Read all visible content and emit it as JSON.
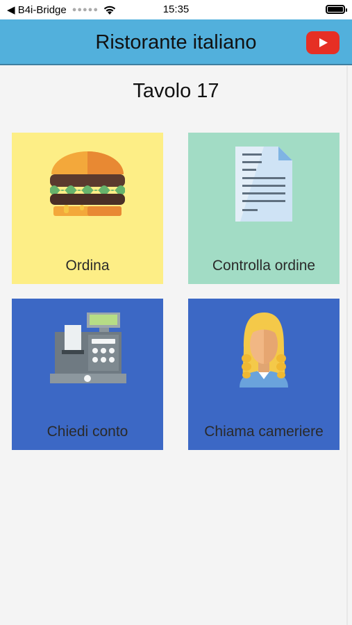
{
  "status_bar": {
    "back_label": "◀ B4i-Bridge",
    "dots": "●●●●●",
    "time": "15:35"
  },
  "navbar": {
    "title": "Ristorante italiano",
    "youtube_icon": "youtube-play-icon"
  },
  "main": {
    "table_title": "Tavolo 17",
    "tiles": [
      {
        "label": "Ordina",
        "icon": "hamburger-icon",
        "color": "#fdee86"
      },
      {
        "label": "Controlla ordine",
        "icon": "document-icon",
        "color": "#a2dcc5"
      },
      {
        "label": "Chiedi conto",
        "icon": "cash-register-icon",
        "color": "#3c68c5"
      },
      {
        "label": "Chiama cameriere",
        "icon": "waiter-icon",
        "color": "#3c68c5"
      }
    ]
  },
  "colors": {
    "navbar": "#52b0dc",
    "youtube_red": "#e62f24",
    "background": "#f4f4f4"
  }
}
